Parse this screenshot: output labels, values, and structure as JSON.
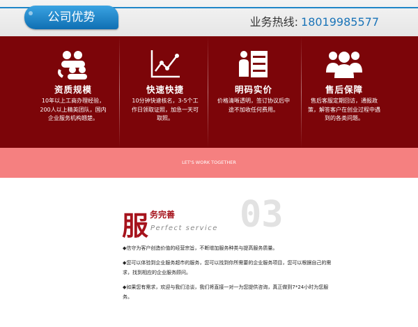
{
  "header": {
    "tab_label": "公司优势",
    "hotline_label": "业务热线:",
    "hotline_number": "18019985577"
  },
  "features": [
    {
      "icon": "people-icon",
      "title": "资质规模",
      "desc": "10年以上工商办理经验，200人以上精英团队，国内企业服务机构翘楚。"
    },
    {
      "icon": "chart-icon",
      "title": "快速快捷",
      "desc": "10分钟快速核名，3-5个工作日领取证照，加急一天可取照。"
    },
    {
      "icon": "price-list-icon",
      "title": "明码实价",
      "desc": "价格清晰透明，签订协议后中途不加收任何费用。"
    },
    {
      "icon": "team-icon",
      "title": "售后保障",
      "desc": "售后客服定期回访，通报政策，解答客户在创业过程中遇到的各类问题。"
    }
  ],
  "banner_text": "LET'S WORK TOGETHER",
  "service": {
    "big_char": "服",
    "cn_title": "务完善",
    "en_title": "Perfect service",
    "number": "03",
    "items": [
      "◆信守为客户创造价值的经营宗旨，不断增加服务种类与提高服务质量。",
      "◆您可以体验到企业服务超市的服务，您可以找到你所需要的企业服务项目，您可以根据自己的需求，找到相应的企业服务顾问。",
      "◆如果您有需求，欢迎与我们洽谈，我们将直接一对一为您提供咨询，真正做到7*24小时为您服务。"
    ]
  },
  "colors": {
    "band": "#7c0509",
    "pink": "#f58080",
    "tab": "#1f86c8",
    "accent": "#a6131c"
  }
}
